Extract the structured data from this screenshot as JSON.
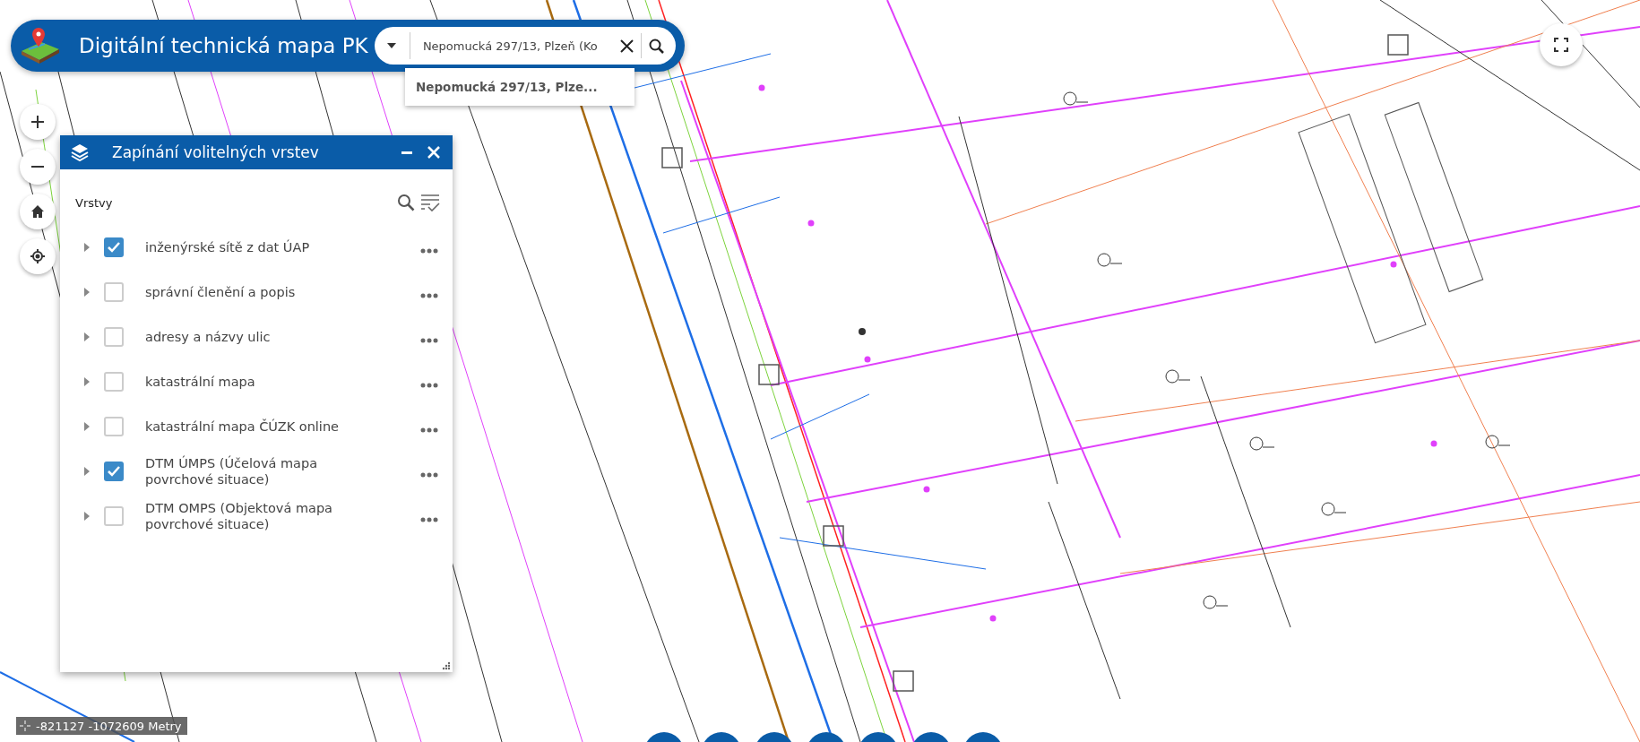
{
  "header": {
    "title": "Digitální technická mapa PK",
    "search": {
      "value": "Nepomucká 297/13, Plzeň (Ko"
    },
    "suggestion": "Nepomucká 297/13, Plze..."
  },
  "layer_panel": {
    "title": "Zapínání volitelných vrstev",
    "section": "Vrstvy",
    "layers": [
      {
        "label": "inženýrské sítě z dat ÚAP",
        "checked": true
      },
      {
        "label": "správní členění a popis",
        "checked": false
      },
      {
        "label": "adresy a názvy ulic",
        "checked": false
      },
      {
        "label": "katastrální mapa",
        "checked": false
      },
      {
        "label": "katastrální mapa ČÚZK online",
        "checked": false
      },
      {
        "label": "DTM ÚMPS (Účelová mapa povrchové situace)",
        "checked": true
      },
      {
        "label": "DTM OMPS (Objektová mapa povrchové situace)",
        "checked": false
      }
    ]
  },
  "coordinates": "-821127 -1072609 Metry"
}
